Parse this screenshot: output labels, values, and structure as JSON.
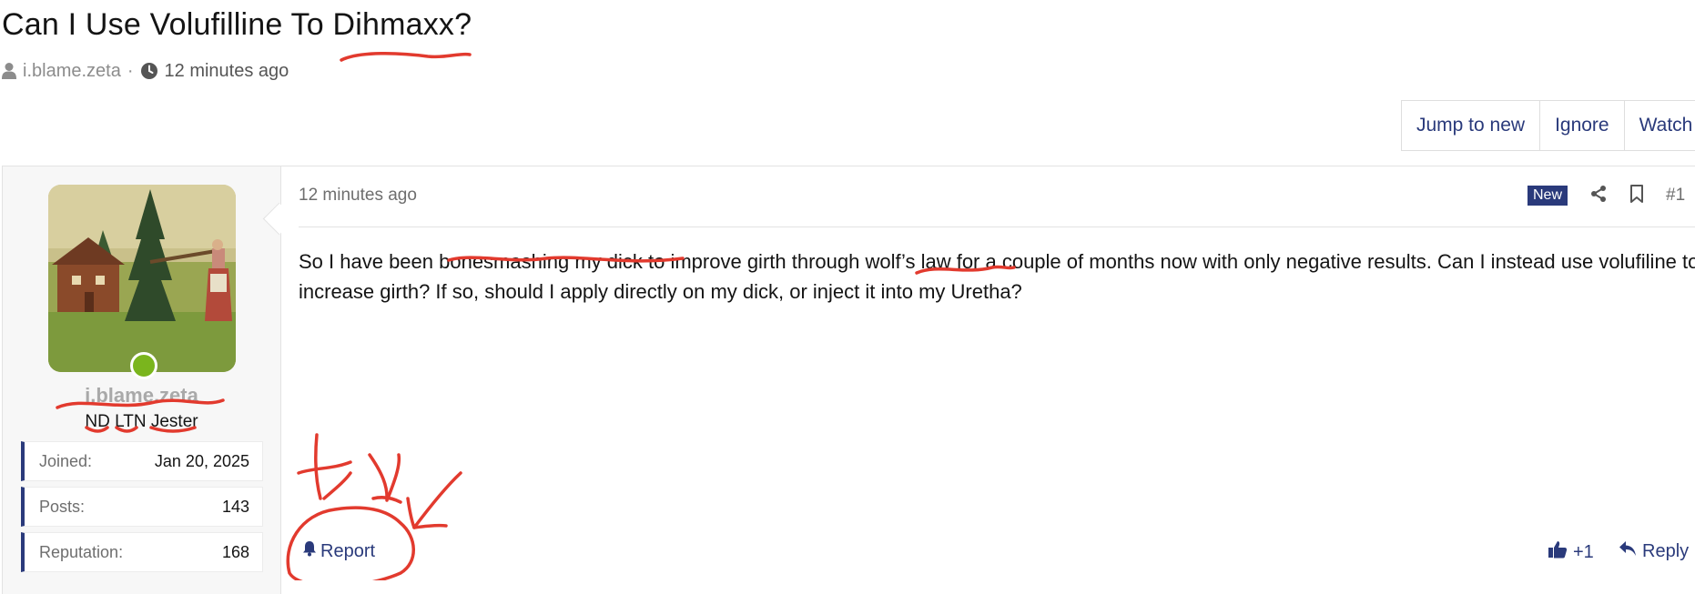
{
  "thread": {
    "title": "Can I Use Volufilline To Dihmaxx?",
    "author": "i.blame.zeta",
    "separator": "·",
    "time": "12 minutes ago"
  },
  "actions": {
    "jump": "Jump to new",
    "ignore": "Ignore",
    "watch": "Watch"
  },
  "user": {
    "name": "i.blame.zeta",
    "title": "ND LTN Jester",
    "status": "online",
    "stats": [
      {
        "label": "Joined:",
        "value": "Jan 20, 2025"
      },
      {
        "label": "Posts:",
        "value": "143"
      },
      {
        "label": "Reputation:",
        "value": "168"
      }
    ]
  },
  "post": {
    "time": "12 minutes ago",
    "badge": "New",
    "number": "#1",
    "body": "So I have been bonesmashing my dick to improve girth through wolf’s law for a couple of months now with only negative results. Can I instead use volufiline to increase girth? If so, should I apply directly on my dick, or inject it into my Uretha?",
    "report": "Report",
    "like": "+1",
    "reply": "Reply"
  },
  "colors": {
    "accent": "#2a3a7b",
    "online": "#7ab51d",
    "annotation": "#e23a2e"
  },
  "icons": [
    "user-icon",
    "clock-icon",
    "share-icon",
    "bookmark-icon",
    "bell-icon",
    "thumbs-up-icon",
    "reply-icon"
  ]
}
